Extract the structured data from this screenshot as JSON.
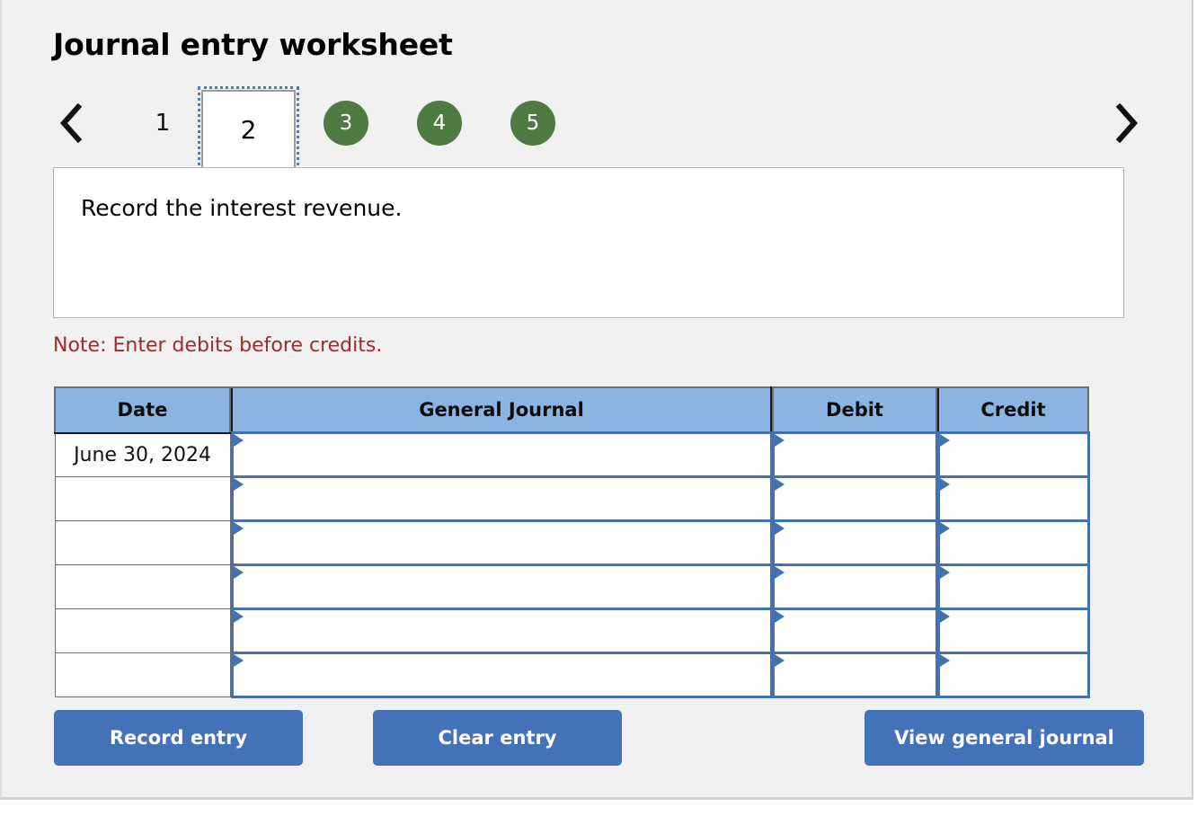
{
  "page_title": "Journal entry worksheet",
  "pager": {
    "prev_icon": "chevron-left-icon",
    "next_icon": "chevron-right-icon",
    "steps": [
      {
        "label": "1",
        "state": "completed-plain"
      },
      {
        "label": "2",
        "state": "current"
      },
      {
        "label": "3",
        "state": "pending"
      },
      {
        "label": "4",
        "state": "pending"
      },
      {
        "label": "5",
        "state": "pending"
      }
    ],
    "pending_color": "#4f7a42",
    "focus_ring_color": "#4a7ebb"
  },
  "instruction": {
    "text": "Record the interest revenue."
  },
  "note": {
    "text": "Note: Enter debits before credits.",
    "color": "#a02b2b"
  },
  "table": {
    "header_color": "#8cb4e3",
    "input_border_color": "#4472b0",
    "columns": [
      {
        "key": "date",
        "label": "Date"
      },
      {
        "key": "journal",
        "label": "General Journal"
      },
      {
        "key": "debit",
        "label": "Debit"
      },
      {
        "key": "credit",
        "label": "Credit"
      }
    ],
    "rows": [
      {
        "date": "June 30, 2024",
        "journal": "",
        "debit": "",
        "credit": ""
      },
      {
        "date": "",
        "journal": "",
        "debit": "",
        "credit": ""
      },
      {
        "date": "",
        "journal": "",
        "debit": "",
        "credit": ""
      },
      {
        "date": "",
        "journal": "",
        "debit": "",
        "credit": ""
      },
      {
        "date": "",
        "journal": "",
        "debit": "",
        "credit": ""
      },
      {
        "date": "",
        "journal": "",
        "debit": "",
        "credit": ""
      }
    ]
  },
  "buttons": {
    "record_label": "Record entry",
    "clear_label": "Clear entry",
    "view_label": "View general journal",
    "color": "#4472b8"
  }
}
